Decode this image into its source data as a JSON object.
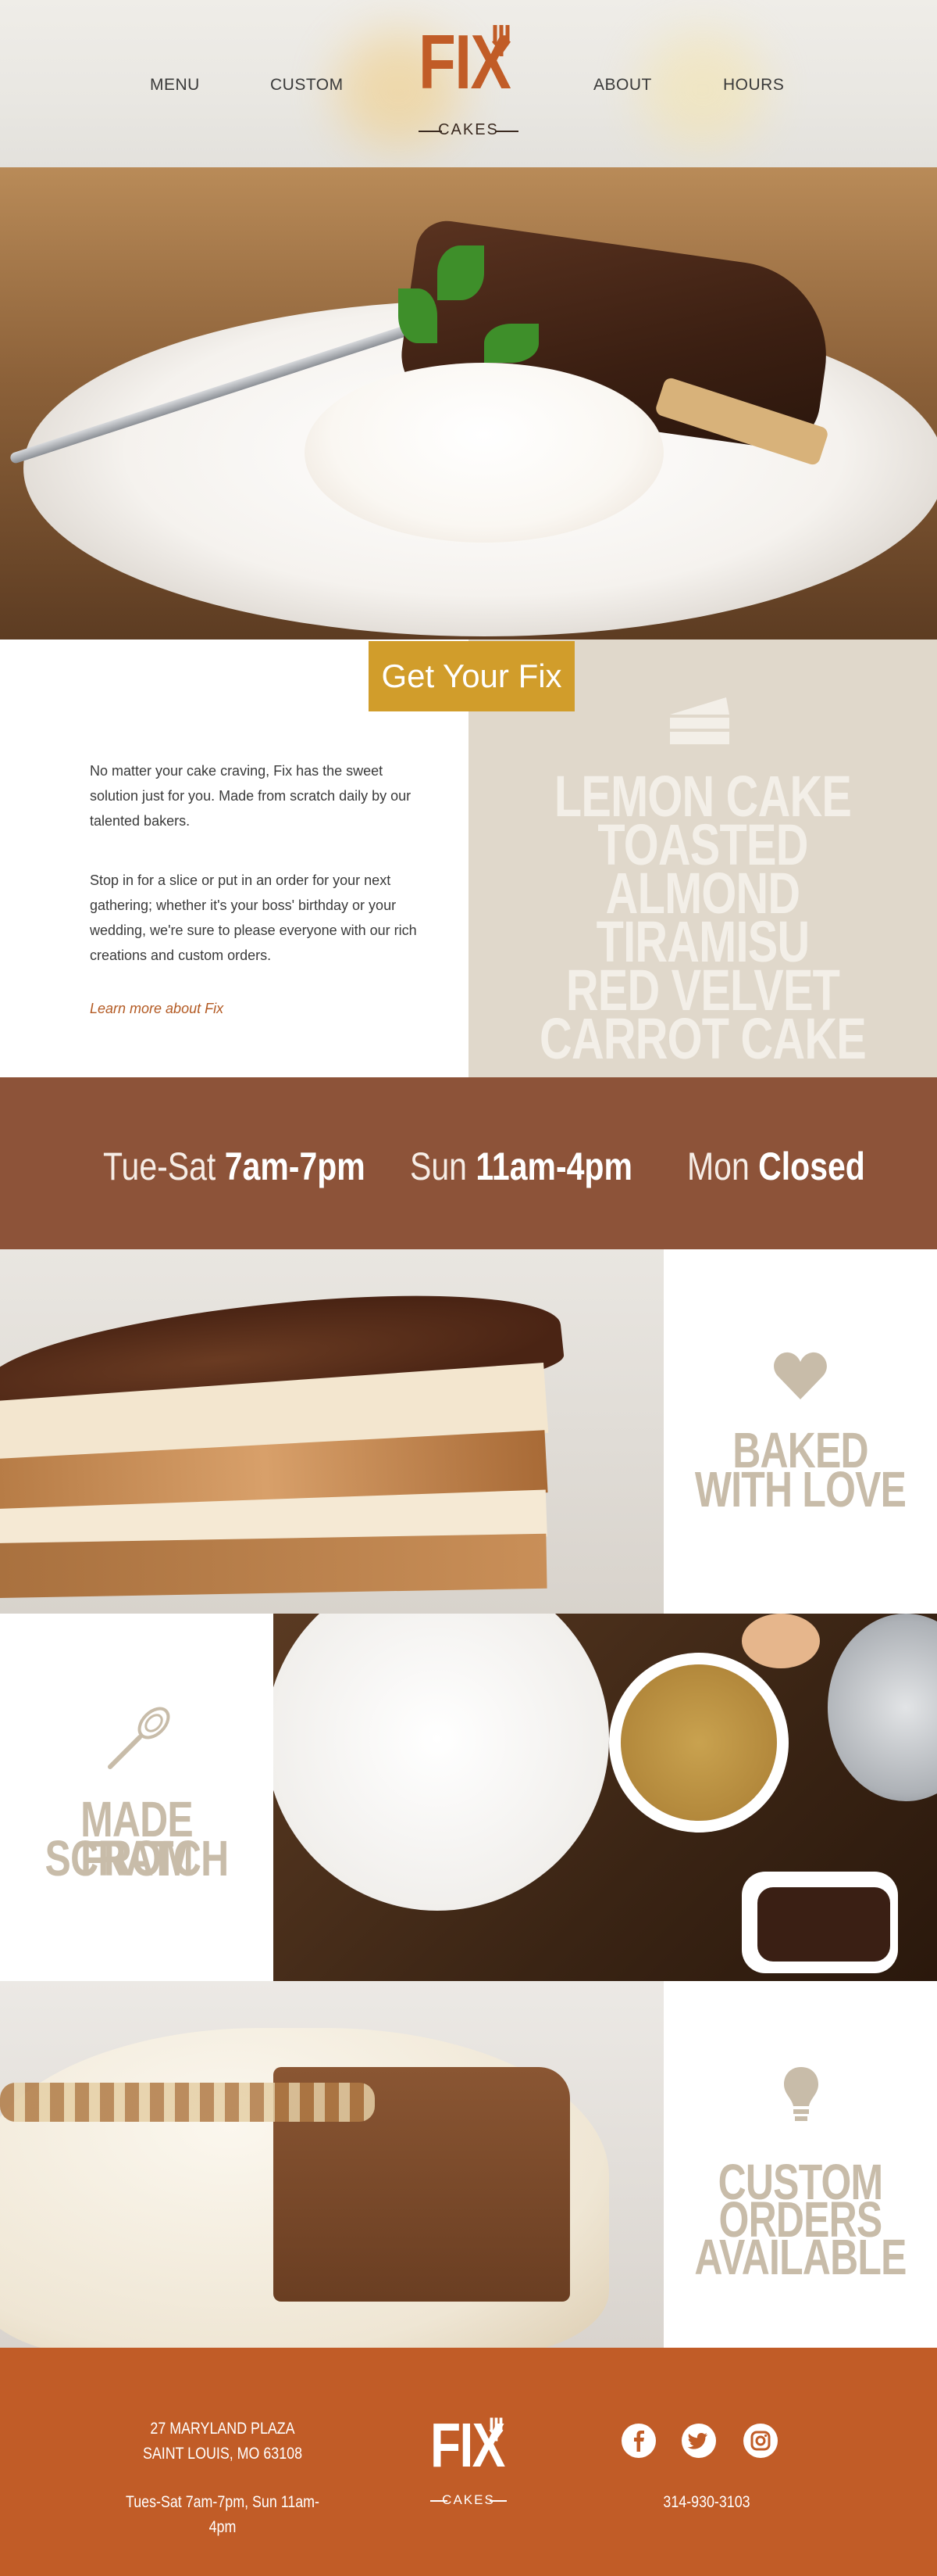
{
  "nav": {
    "menu": "MENU",
    "custom": "CUSTOM",
    "about": "ABOUT",
    "hours": "HOURS"
  },
  "logo": {
    "main": "FIX",
    "sub": "CAKES"
  },
  "intro": {
    "tab_label": "Get Your Fix",
    "paragraph1": "No matter your cake craving, Fix has the sweet solution just for you. Made from scratch daily by our talented bakers.",
    "paragraph2": "Stop in for a slice or put in an order for your next gathering; whether it's your boss' birthday or your wedding, we're sure to please everyone with our rich creations and custom orders.",
    "learn_more": "Learn more about Fix"
  },
  "flavors": [
    "LEMON CAKE",
    "TOASTED ALMOND",
    "TIRAMISU",
    "RED VELVET",
    "CARROT CAKE"
  ],
  "hours": [
    {
      "days": "Tue-Sat",
      "time": "7am-7pm"
    },
    {
      "days": "Sun",
      "time": "11am-4pm"
    },
    {
      "days": "Mon",
      "time": "Closed"
    }
  ],
  "features": {
    "baked": [
      "BAKED",
      "WITH LOVE"
    ],
    "scratch": [
      "MADE FROM",
      "SCRATCH"
    ],
    "custom": [
      "CUSTOM",
      "ORDERS",
      "AVAILABLE"
    ]
  },
  "footer": {
    "address1": "27 MARYLAND PLAZA",
    "address2": "SAINT LOUIS, MO 63108",
    "hours": "Tues-Sat 7am-7pm, Sun 11am-4pm",
    "phone": "314-930-3103",
    "social": [
      "facebook-icon",
      "twitter-icon",
      "instagram-icon"
    ]
  },
  "colors": {
    "brand_orange": "#c15c27",
    "hours_band": "#8d5339",
    "tab_gold": "#d19d2b",
    "flavor_panel": "#e0d8cb",
    "tile_label": "#c8bca9"
  }
}
